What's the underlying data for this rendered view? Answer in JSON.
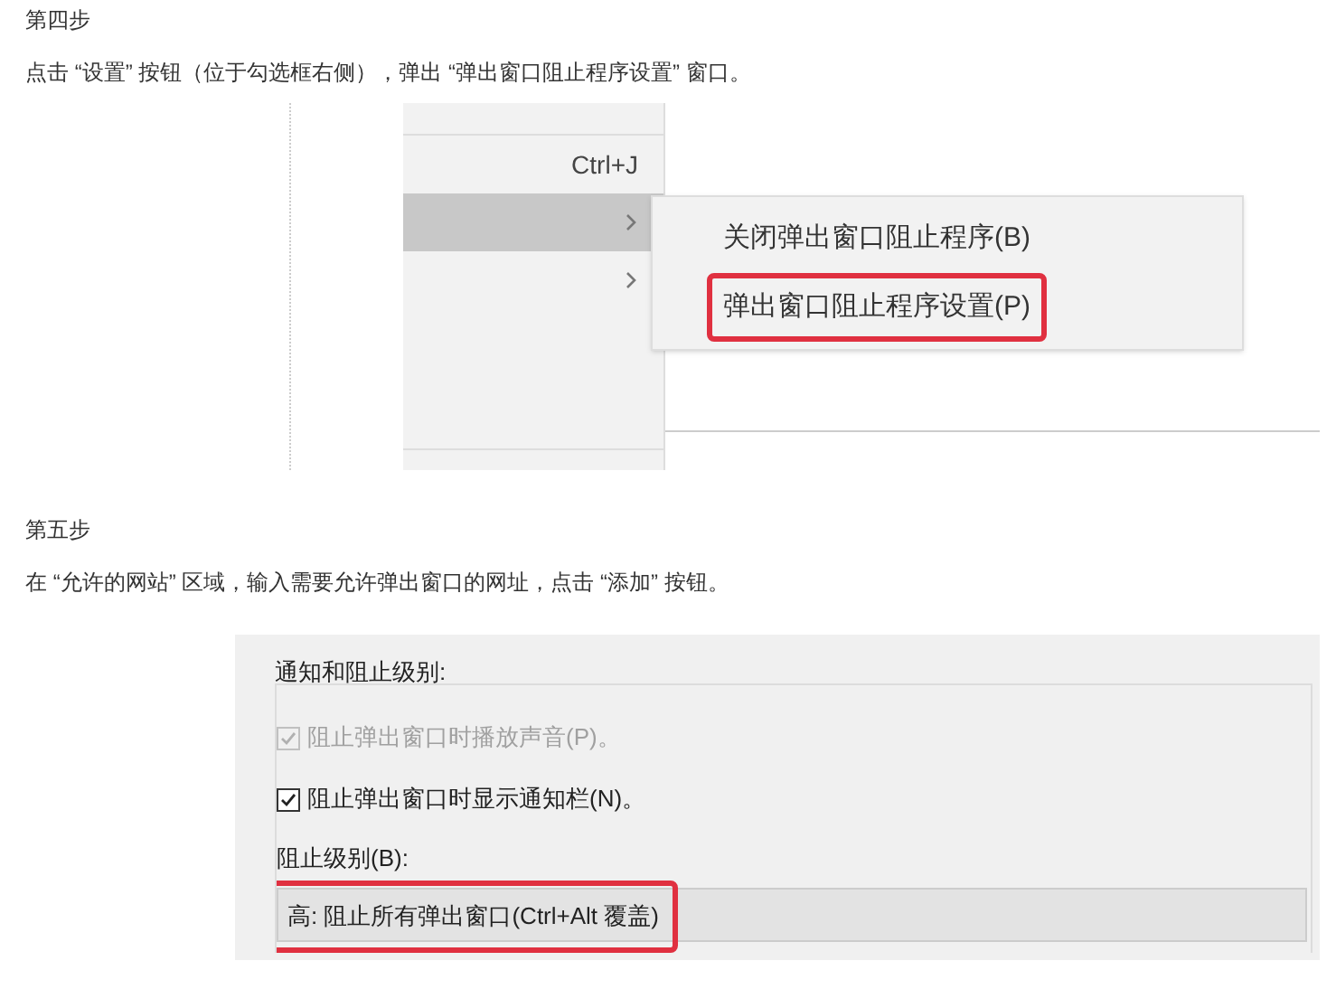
{
  "step4": {
    "heading": "第四步",
    "instruction": "点击 “设置” 按钮（位于勾选框右侧），弹出 “弹出窗口阻止程序设置” 窗口。"
  },
  "screenshot1": {
    "menu_rows": [
      {
        "shortcut": "Ctrl+J",
        "submenu": false,
        "selected": false
      },
      {
        "submenu": true,
        "selected": true
      },
      {
        "submenu": true,
        "selected": false
      }
    ],
    "submenu_items": [
      {
        "label": "关闭弹出窗口阻止程序(B)",
        "highlighted": false
      },
      {
        "label": "弹出窗口阻止程序设置(P)",
        "highlighted": true
      }
    ]
  },
  "step5": {
    "heading": "第五步",
    "instruction": "在 “允许的网站” 区域，输入需要允许弹出窗口的网址，点击 “添加” 按钮。"
  },
  "screenshot2": {
    "group_label": "通知和阻止级别:",
    "checkboxes": [
      {
        "label": "阻止弹出窗口时播放声音(P)。",
        "checked": true,
        "disabled": true
      },
      {
        "label": "阻止弹出窗口时显示通知栏(N)。",
        "checked": true,
        "disabled": false
      }
    ],
    "level_label": "阻止级别(B):",
    "level_dropdown": {
      "value": "高: 阻止所有弹出窗口(Ctrl+Alt 覆盖)",
      "highlighted": true
    }
  }
}
